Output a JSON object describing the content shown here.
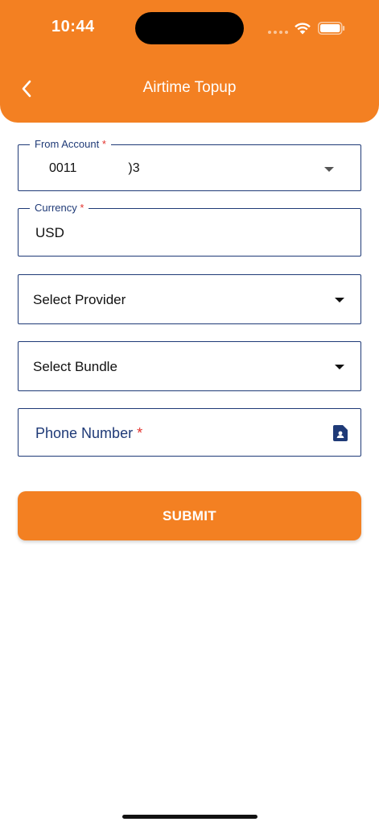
{
  "status_bar": {
    "time": "10:44"
  },
  "header": {
    "title": "Airtime Topup",
    "back_icon": "chevron-left-icon",
    "color": "#F38022"
  },
  "form": {
    "from_account": {
      "label": "From Account",
      "required_mark": "*",
      "value_start": "0011",
      "value_end": ")3"
    },
    "currency": {
      "label": "Currency",
      "required_mark": "*",
      "value": "USD"
    },
    "provider": {
      "placeholder": "Select Provider"
    },
    "bundle": {
      "placeholder": "Select Bundle"
    },
    "phone_number": {
      "placeholder": "Phone Number",
      "required_mark": "*",
      "icon": "contact-card-icon"
    }
  },
  "actions": {
    "submit_label": "SUBMIT"
  },
  "colors": {
    "accent": "#F38022",
    "border": "#1F3A77",
    "required": "#E3342F"
  }
}
